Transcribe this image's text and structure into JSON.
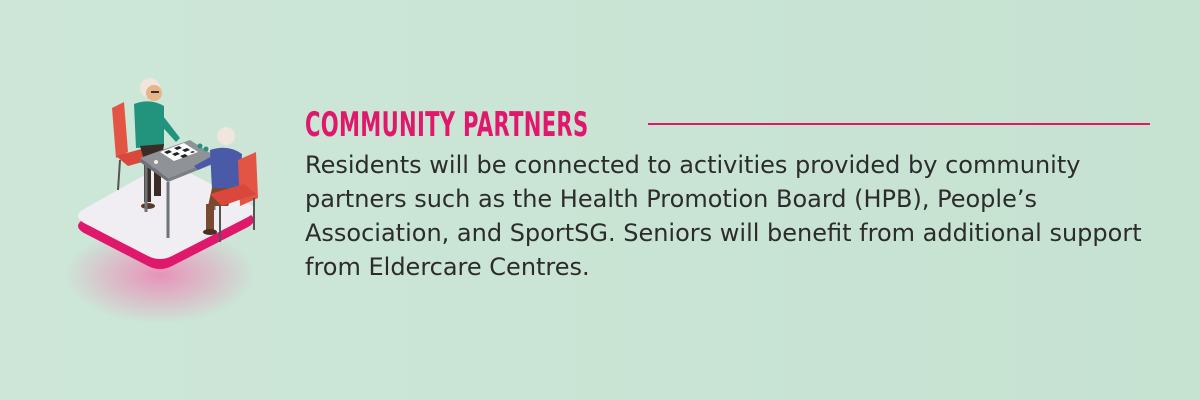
{
  "heading": "COMMUNITY PARTNERS",
  "body": "Residents will be connected to activities provided by community partners such as the Health Promotion Board (HPB), People’s Association, and SportSG. Seniors will benefit from additional support from Eldercare Centres.",
  "colors": {
    "accent": "#e0186c",
    "background": "#c9e4d5",
    "text": "#2c2c2c"
  },
  "illustration": {
    "icon": "seniors-playing-checkers-icon"
  }
}
